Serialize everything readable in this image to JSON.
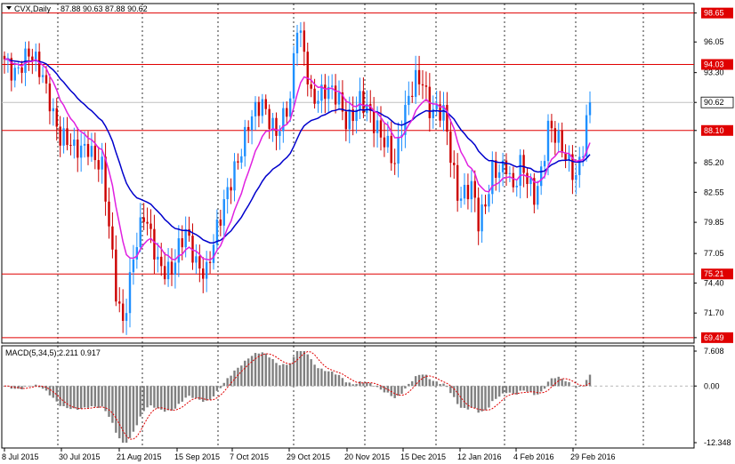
{
  "chart_data": {
    "type": "candlestick",
    "title": "CVX,Daily  87.88 90.63 87.88 90.62",
    "symbol_label": "CVX,Daily",
    "ohlc_label": "87.88 90.63 87.88 90.62",
    "price_axis": {
      "ylim": [
        69.0,
        99.5
      ],
      "ticks": [
        "98.65",
        "96.05",
        "93.30",
        "90.62",
        "88.10",
        "85.20",
        "82.55",
        "79.85",
        "77.05",
        "74.40",
        "71.70",
        "69.49"
      ],
      "tick_values": [
        98.65,
        96.05,
        93.3,
        90.62,
        88.1,
        85.2,
        82.55,
        79.85,
        77.05,
        74.4,
        71.7,
        69.49
      ]
    },
    "levels": [
      {
        "value": 98.65,
        "label": "98.65",
        "color": "#e00000"
      },
      {
        "value": 94.03,
        "label": "94.03",
        "color": "#e00000"
      },
      {
        "value": 88.1,
        "label": "88.10",
        "color": "#e00000"
      },
      {
        "value": 75.21,
        "label": "75.21",
        "color": "#e00000"
      },
      {
        "value": 69.49,
        "label": "69.49",
        "color": "#e00000"
      }
    ],
    "current_price": {
      "value": 90.62,
      "label": "90.62"
    },
    "x_labels": [
      "8 Jul 2015",
      "30 Jul 2015",
      "21 Aug 2015",
      "15 Sep 2015",
      "7 Oct 2015",
      "29 Oct 2015",
      "20 Nov 2015",
      "15 Dec 2015",
      "12 Jan 2016",
      "4 Feb 2016",
      "29 Feb 2016"
    ],
    "anchor_points": [
      [
        0,
        94.5
      ],
      [
        3,
        93.8
      ],
      [
        7,
        94.6
      ],
      [
        11,
        93.0
      ],
      [
        13,
        91.3
      ],
      [
        16,
        87.5
      ],
      [
        20,
        86.0
      ],
      [
        24,
        87.2
      ],
      [
        28,
        84.5
      ],
      [
        32,
        73.5
      ],
      [
        34,
        71.2
      ],
      [
        37,
        77.0
      ],
      [
        40,
        80.0
      ],
      [
        44,
        76.5
      ],
      [
        48,
        75.7
      ],
      [
        52,
        78.5
      ],
      [
        55,
        76.5
      ],
      [
        58,
        75.8
      ],
      [
        62,
        79.8
      ],
      [
        66,
        85.0
      ],
      [
        70,
        88.8
      ],
      [
        74,
        90.0
      ],
      [
        78,
        88.5
      ],
      [
        82,
        90.5
      ],
      [
        84,
        97.2
      ],
      [
        86,
        95.0
      ],
      [
        88,
        91.5
      ],
      [
        92,
        91.6
      ],
      [
        96,
        90.5
      ],
      [
        98,
        89.2
      ],
      [
        102,
        91.0
      ],
      [
        106,
        88.2
      ],
      [
        110,
        87.3
      ],
      [
        112,
        85.5
      ],
      [
        114,
        88.3
      ],
      [
        118,
        92.5
      ],
      [
        120,
        93.0
      ],
      [
        122,
        90.5
      ],
      [
        126,
        89.2
      ],
      [
        128,
        85.5
      ],
      [
        130,
        82.5
      ],
      [
        134,
        83.5
      ],
      [
        136,
        79.5
      ],
      [
        138,
        80.8
      ],
      [
        140,
        84.5
      ],
      [
        144,
        85.5
      ],
      [
        146,
        82.5
      ],
      [
        148,
        84.5
      ],
      [
        152,
        82.5
      ],
      [
        154,
        84.8
      ],
      [
        156,
        88.5
      ],
      [
        160,
        86.0
      ],
      [
        164,
        84.5
      ],
      [
        166,
        87.0
      ],
      [
        168,
        90.62
      ]
    ],
    "bar_count": 169,
    "colors": {
      "up": "#1e90ff",
      "down": "#cc0000",
      "ma_fast": "#e020e0",
      "ma_slow": "#0000cc",
      "level_line": "#e00000",
      "macd_hist": "#808080",
      "macd_signal": "#e00000"
    },
    "macd": {
      "label": "MACD(5,34,5) 2.211 0.917",
      "ylim": [
        -12.348,
        7.608
      ],
      "ticks": [
        "7.608",
        "0.00",
        "-12.348"
      ],
      "tick_values": [
        7.608,
        0.0,
        -12.348
      ]
    }
  }
}
